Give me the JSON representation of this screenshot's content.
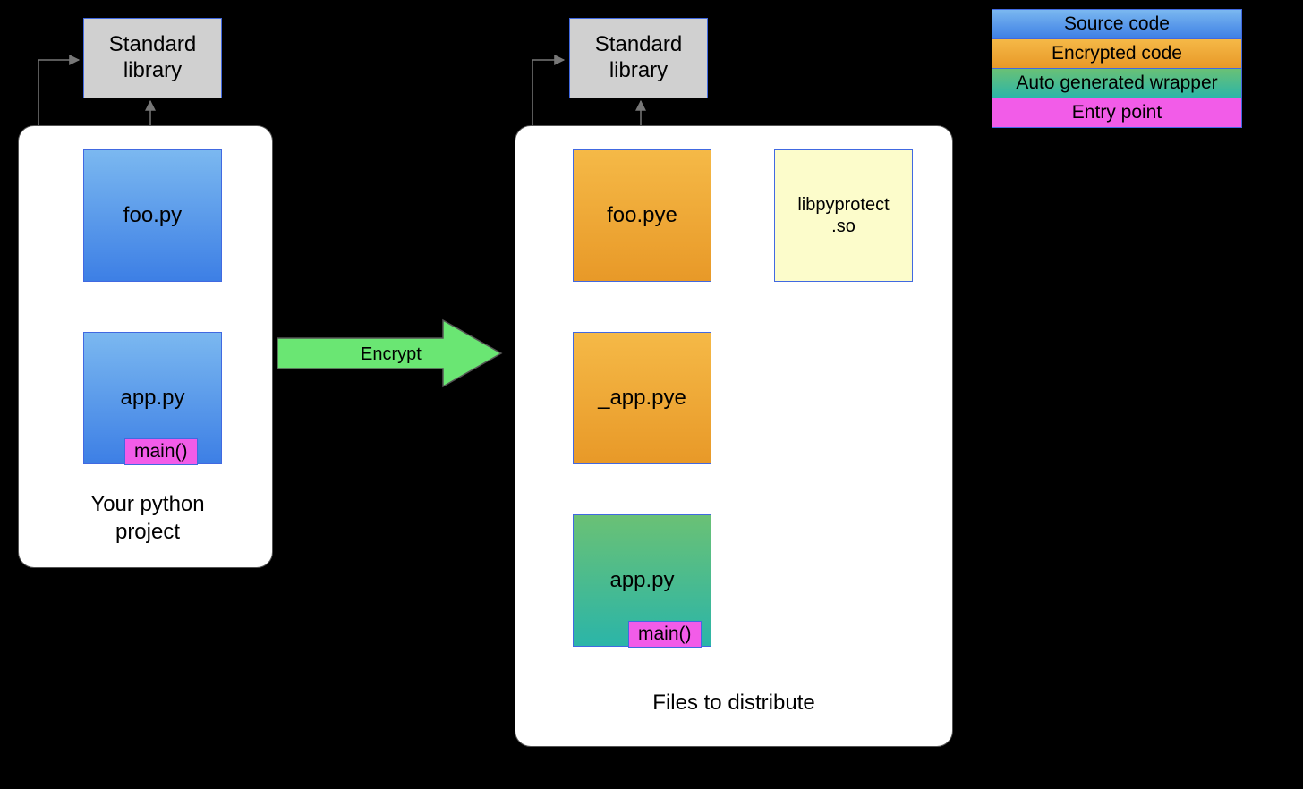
{
  "left": {
    "stdlib": "Standard\nlibrary",
    "foo": "foo.py",
    "app": "app.py",
    "main": "main()",
    "caption": "Your python\nproject"
  },
  "right": {
    "stdlib": "Standard\nlibrary",
    "foo": "foo.pye",
    "app_enc": "_app.pye",
    "app": "app.py",
    "main": "main()",
    "lib": "libpyprotect\n.so",
    "caption": "Files to distribute"
  },
  "arrow_label": "Encrypt",
  "legend": {
    "source": "Source code",
    "encrypted": "Encrypted code",
    "wrapper": "Auto generated wrapper",
    "entry": "Entry point"
  }
}
